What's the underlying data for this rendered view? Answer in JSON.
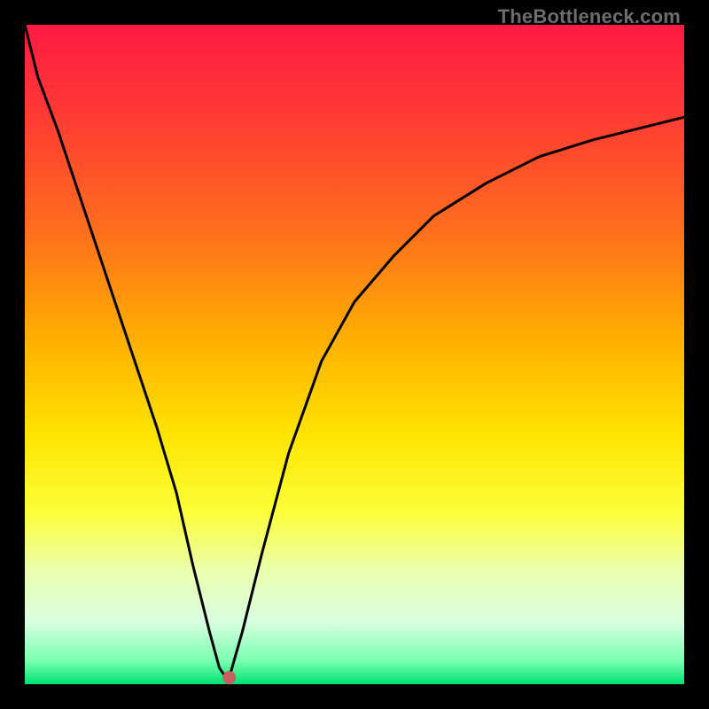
{
  "watermark": "TheBottleneck.com",
  "colors": {
    "frame": "#000000",
    "curve": "#000000",
    "marker": "#c46060",
    "gradient_stops": [
      {
        "offset": 0.0,
        "color": "#ff1a43"
      },
      {
        "offset": 0.12,
        "color": "#ff3636"
      },
      {
        "offset": 0.3,
        "color": "#ff6a1f"
      },
      {
        "offset": 0.48,
        "color": "#ffb000"
      },
      {
        "offset": 0.62,
        "color": "#ffe400"
      },
      {
        "offset": 0.74,
        "color": "#fbff3a"
      },
      {
        "offset": 0.83,
        "color": "#eaffb0"
      },
      {
        "offset": 0.905,
        "color": "#d8ffe0"
      },
      {
        "offset": 0.965,
        "color": "#7affb0"
      },
      {
        "offset": 1.0,
        "color": "#00e070"
      }
    ]
  },
  "chart_data": {
    "type": "line",
    "title": "",
    "xlabel": "",
    "ylabel": "",
    "xlim": [
      0,
      100
    ],
    "ylim": [
      0,
      100
    ],
    "grid": false,
    "legend": false,
    "series": [
      {
        "name": "bottleneck-curve",
        "x": [
          0,
          2,
          5,
          8,
          11,
          14,
          17,
          20,
          23,
          25.5,
          28,
          29.5,
          30.5,
          31,
          33,
          36,
          40,
          45,
          50,
          56,
          62,
          70,
          78,
          86,
          94,
          100
        ],
        "y": [
          100,
          92,
          84,
          75,
          66,
          57,
          48,
          39,
          29,
          18,
          8,
          2.5,
          1,
          1,
          8,
          20,
          35,
          49,
          58,
          65,
          71,
          76,
          80,
          82.5,
          84.5,
          86
        ]
      }
    ],
    "marker": {
      "x": 31,
      "y": 1,
      "r_percent": 1.0
    }
  }
}
